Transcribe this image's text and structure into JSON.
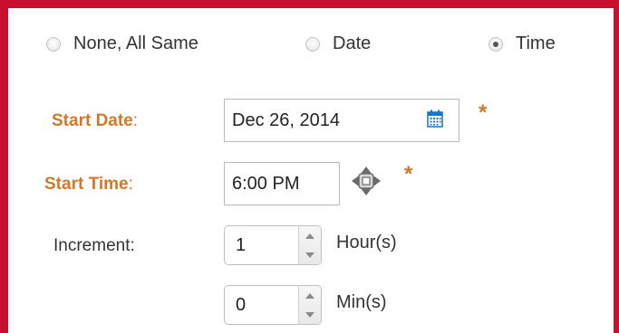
{
  "radio_group": {
    "options": [
      {
        "label": "None, All Same",
        "checked": false
      },
      {
        "label": "Date",
        "checked": false
      },
      {
        "label": "Time",
        "checked": true
      }
    ]
  },
  "start_date": {
    "label": "Start Date",
    "colon": ":",
    "value": "Dec 26, 2014",
    "required_mark": "*"
  },
  "start_time": {
    "label": "Start Time",
    "colon": ":",
    "value": "6:00 PM",
    "required_mark": "*"
  },
  "increment": {
    "label": "Increment:",
    "hours": {
      "value": "1",
      "unit": "Hour(s)"
    },
    "minutes": {
      "value": "0",
      "unit": "Min(s)"
    }
  },
  "colors": {
    "frame_border": "#c8102e",
    "required_label": "#d2782a",
    "calendar_icon": "#1a73c8"
  },
  "icons": {
    "date_picker": "calendar-icon",
    "time_picker": "move-arrows-icon"
  }
}
